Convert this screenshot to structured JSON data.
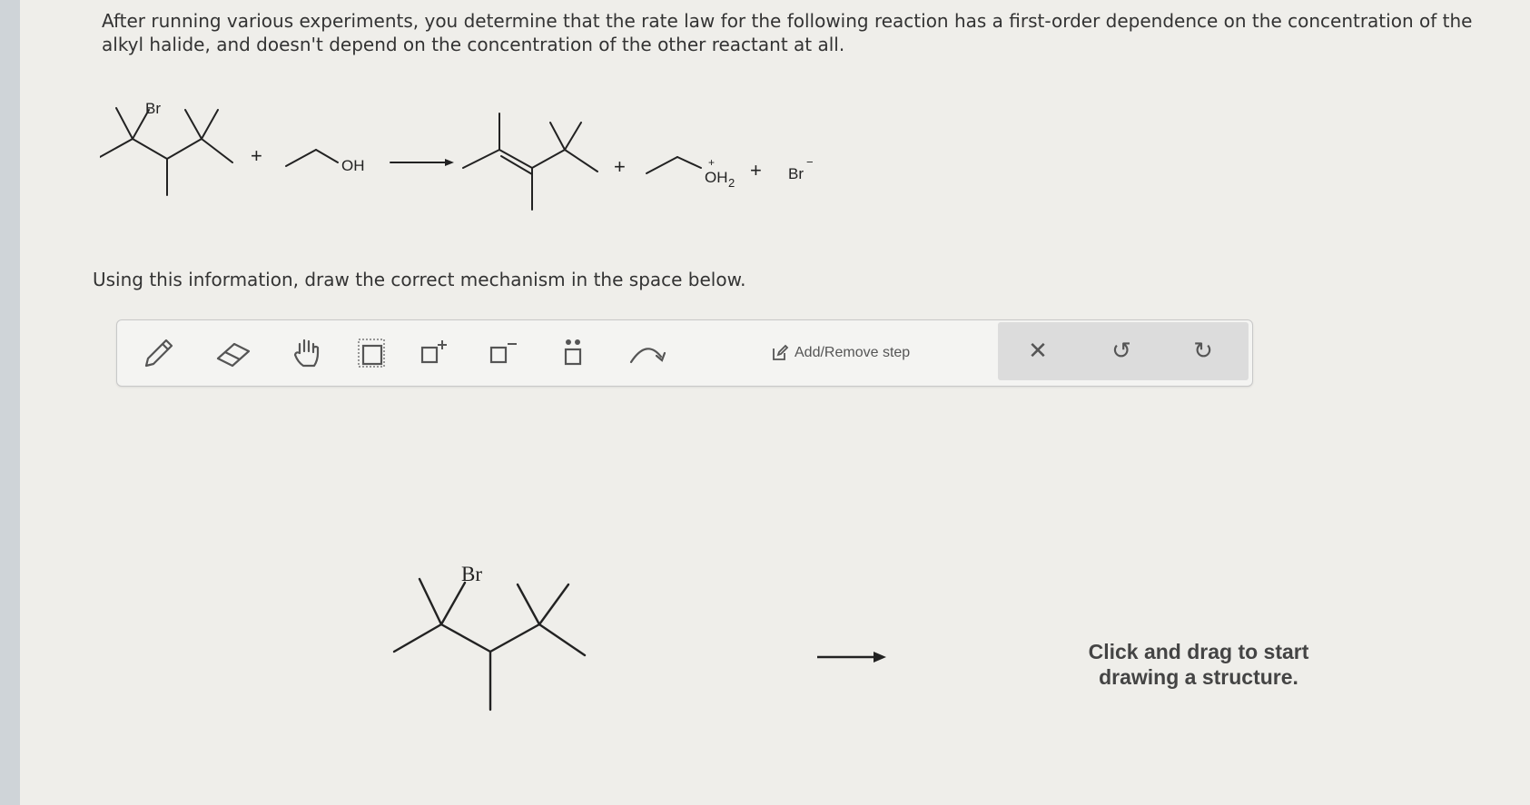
{
  "question": {
    "text": "After running various experiments, you determine that the rate law for the following reaction has a first-order dependence on the concentration of the alkyl halide, and doesn't depend on the concentration of the other reactant at all."
  },
  "reaction": {
    "reactant1_label": "Br",
    "plus1": "+",
    "reactant2_label": "OH",
    "plus2": "+",
    "product2_label": "OH",
    "product2_subscript": "2",
    "product2_charge": "+",
    "plus3": "+",
    "product3_label": "Br",
    "product3_charge": "−"
  },
  "instruction": "Using this information, draw the correct mechanism in the space below.",
  "toolbar": {
    "tools": [
      "pencil-icon",
      "eraser-icon",
      "hand-icon",
      "select-box-icon",
      "positive-charge-icon",
      "negative-charge-icon",
      "lone-pair-icon",
      "curved-arrow-icon"
    ],
    "add_remove_step_label": "Add/Remove step",
    "clear_symbol": "✕",
    "undo_symbol": "↺",
    "redo_symbol": "↻"
  },
  "canvas": {
    "structure_label": "Br",
    "hint": "Click and drag to start drawing a structure."
  }
}
